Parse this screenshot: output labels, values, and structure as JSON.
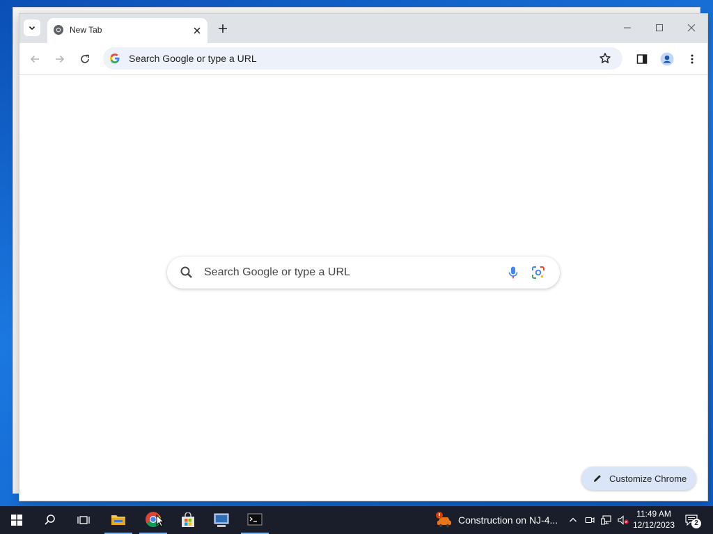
{
  "browser": {
    "tab": {
      "title": "New Tab"
    },
    "omnibox": {
      "placeholder": "Search Google or type a URL"
    }
  },
  "new_tab_page": {
    "search_placeholder": "Search Google or type a URL",
    "customize_label": "Customize Chrome"
  },
  "taskbar": {
    "weather_text": "Construction on NJ-4...",
    "time": "11:49 AM",
    "date": "12/12/2023",
    "notification_count": "2"
  },
  "colors": {
    "omnibox_bg": "#edf2fa",
    "customize_bg": "#dae6f8",
    "taskbar_bg": "#1a1e2a",
    "desktop_blue": "#1573d6"
  }
}
